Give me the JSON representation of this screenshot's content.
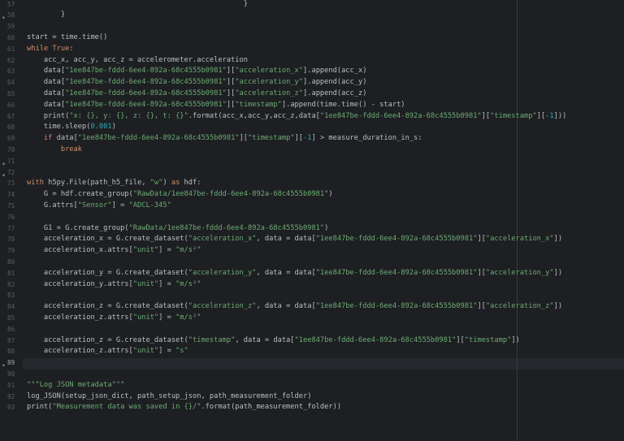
{
  "editor": {
    "current_line": 89,
    "lines": [
      {
        "n": "57",
        "segs": [
          {
            "t": "                                                   }",
            "c": "fn"
          }
        ]
      },
      {
        "n": "58",
        "fold": true,
        "segs": [
          {
            "t": "        }",
            "c": "fn"
          }
        ]
      },
      {
        "n": "59",
        "segs": []
      },
      {
        "n": "60",
        "segs": [
          {
            "t": "start = time.time()",
            "c": "fn"
          }
        ]
      },
      {
        "n": "61",
        "segs": [
          {
            "t": "while",
            "c": "kw"
          },
          {
            "t": " ",
            "c": "fn"
          },
          {
            "t": "True",
            "c": "kw"
          },
          {
            "t": ":",
            "c": "fn"
          }
        ]
      },
      {
        "n": "62",
        "segs": [
          {
            "t": "    acc_x, acc_y, acc_z = accelerometer.acceleration",
            "c": "fn"
          }
        ]
      },
      {
        "n": "63",
        "segs": [
          {
            "t": "    data[",
            "c": "fn"
          },
          {
            "t": "\"1ee847be-fddd-6ee4-892a-68c4555b0981\"",
            "c": "str"
          },
          {
            "t": "][",
            "c": "fn"
          },
          {
            "t": "\"acceleration_x\"",
            "c": "str"
          },
          {
            "t": "].append(acc_x)",
            "c": "fn"
          }
        ]
      },
      {
        "n": "64",
        "segs": [
          {
            "t": "    data[",
            "c": "fn"
          },
          {
            "t": "\"1ee847be-fddd-6ee4-892a-68c4555b0981\"",
            "c": "str"
          },
          {
            "t": "][",
            "c": "fn"
          },
          {
            "t": "\"acceleration_y\"",
            "c": "str"
          },
          {
            "t": "].append(acc_y)",
            "c": "fn"
          }
        ]
      },
      {
        "n": "65",
        "segs": [
          {
            "t": "    data[",
            "c": "fn"
          },
          {
            "t": "\"1ee847be-fddd-6ee4-892a-68c4555b0981\"",
            "c": "str"
          },
          {
            "t": "][",
            "c": "fn"
          },
          {
            "t": "\"acceleration_z\"",
            "c": "str"
          },
          {
            "t": "].append(acc_z)",
            "c": "fn"
          }
        ]
      },
      {
        "n": "66",
        "segs": [
          {
            "t": "    data[",
            "c": "fn"
          },
          {
            "t": "\"1ee847be-fddd-6ee4-892a-68c4555b0981\"",
            "c": "str"
          },
          {
            "t": "][",
            "c": "fn"
          },
          {
            "t": "\"timestamp\"",
            "c": "str"
          },
          {
            "t": "].append(time.time() - start)",
            "c": "fn"
          }
        ]
      },
      {
        "n": "67",
        "segs": [
          {
            "t": "    print(",
            "c": "fn"
          },
          {
            "t": "\"x: {}, y: {}, z: {}, t: {}\"",
            "c": "str"
          },
          {
            "t": ".format(acc_x,acc_y,acc_z,data[",
            "c": "fn"
          },
          {
            "t": "\"1ee847be-fddd-6ee4-892a-68c4555b0981\"",
            "c": "str"
          },
          {
            "t": "][",
            "c": "fn"
          },
          {
            "t": "\"timestamp\"",
            "c": "str"
          },
          {
            "t": "][",
            "c": "fn"
          },
          {
            "t": "-1",
            "c": "num"
          },
          {
            "t": "]))",
            "c": "fn"
          }
        ]
      },
      {
        "n": "68",
        "segs": [
          {
            "t": "    time.sleep(",
            "c": "fn"
          },
          {
            "t": "0.001",
            "c": "num"
          },
          {
            "t": ")",
            "c": "fn"
          }
        ]
      },
      {
        "n": "69",
        "segs": [
          {
            "t": "    ",
            "c": "fn"
          },
          {
            "t": "if",
            "c": "kw"
          },
          {
            "t": " data[",
            "c": "fn"
          },
          {
            "t": "\"1ee847be-fddd-6ee4-892a-68c4555b0981\"",
            "c": "str"
          },
          {
            "t": "][",
            "c": "fn"
          },
          {
            "t": "\"timestamp\"",
            "c": "str"
          },
          {
            "t": "][",
            "c": "fn"
          },
          {
            "t": "-1",
            "c": "num"
          },
          {
            "t": "] > measure_duration_in_s:",
            "c": "fn"
          }
        ]
      },
      {
        "n": "70",
        "segs": [
          {
            "t": "        ",
            "c": "fn"
          },
          {
            "t": "break",
            "c": "kw"
          }
        ]
      },
      {
        "n": "71",
        "fold": true,
        "segs": []
      },
      {
        "n": "72",
        "fold": true,
        "segs": []
      },
      {
        "n": "73",
        "segs": [
          {
            "t": "with",
            "c": "kw"
          },
          {
            "t": " h5py.File(path_h5_file, ",
            "c": "fn"
          },
          {
            "t": "\"w\"",
            "c": "str"
          },
          {
            "t": ") ",
            "c": "fn"
          },
          {
            "t": "as",
            "c": "kw"
          },
          {
            "t": " hdf:",
            "c": "fn"
          }
        ]
      },
      {
        "n": "74",
        "segs": [
          {
            "t": "    G = hdf.create_group(",
            "c": "fn"
          },
          {
            "t": "\"RawData/1ee847be-fddd-6ee4-892a-68c4555b0981\"",
            "c": "str"
          },
          {
            "t": ")",
            "c": "fn"
          }
        ]
      },
      {
        "n": "75",
        "segs": [
          {
            "t": "    G.attrs[",
            "c": "fn"
          },
          {
            "t": "\"Sensor\"",
            "c": "str"
          },
          {
            "t": "] = ",
            "c": "fn"
          },
          {
            "t": "\"ADCL-345\"",
            "c": "str"
          }
        ]
      },
      {
        "n": "76",
        "segs": []
      },
      {
        "n": "77",
        "segs": [
          {
            "t": "    G1 = G.create_group(",
            "c": "fn"
          },
          {
            "t": "\"RawData/1ee847be-fddd-6ee4-892a-68c4555b0981\"",
            "c": "str"
          },
          {
            "t": ")",
            "c": "fn"
          }
        ]
      },
      {
        "n": "78",
        "segs": [
          {
            "t": "    acceleration_x = G.create_dataset(",
            "c": "fn"
          },
          {
            "t": "\"acceleration_x\"",
            "c": "str"
          },
          {
            "t": ", data = data[",
            "c": "fn"
          },
          {
            "t": "\"1ee847be-fddd-6ee4-892a-68c4555b0981\"",
            "c": "str"
          },
          {
            "t": "][",
            "c": "fn"
          },
          {
            "t": "\"acceleration_x\"",
            "c": "str"
          },
          {
            "t": "])",
            "c": "fn"
          }
        ]
      },
      {
        "n": "79",
        "segs": [
          {
            "t": "    acceleration_x.attrs[",
            "c": "fn"
          },
          {
            "t": "\"unit\"",
            "c": "str"
          },
          {
            "t": "] = ",
            "c": "fn"
          },
          {
            "t": "\"m/s²\"",
            "c": "str"
          }
        ]
      },
      {
        "n": "80",
        "segs": []
      },
      {
        "n": "81",
        "segs": [
          {
            "t": "    acceleration_y = G.create_dataset(",
            "c": "fn"
          },
          {
            "t": "\"acceleration_y\"",
            "c": "str"
          },
          {
            "t": ", data = data[",
            "c": "fn"
          },
          {
            "t": "\"1ee847be-fddd-6ee4-892a-68c4555b0981\"",
            "c": "str"
          },
          {
            "t": "][",
            "c": "fn"
          },
          {
            "t": "\"acceleration_y\"",
            "c": "str"
          },
          {
            "t": "])",
            "c": "fn"
          }
        ]
      },
      {
        "n": "82",
        "segs": [
          {
            "t": "    acceleration_y.attrs[",
            "c": "fn"
          },
          {
            "t": "\"unit\"",
            "c": "str"
          },
          {
            "t": "] = ",
            "c": "fn"
          },
          {
            "t": "\"m/s²\"",
            "c": "str"
          }
        ]
      },
      {
        "n": "83",
        "segs": []
      },
      {
        "n": "84",
        "segs": [
          {
            "t": "    acceleration_z = G.create_dataset(",
            "c": "fn"
          },
          {
            "t": "\"acceleration_z\"",
            "c": "str"
          },
          {
            "t": ", data = data[",
            "c": "fn"
          },
          {
            "t": "\"1ee847be-fddd-6ee4-892a-68c4555b0981\"",
            "c": "str"
          },
          {
            "t": "][",
            "c": "fn"
          },
          {
            "t": "\"acceleration_z\"",
            "c": "str"
          },
          {
            "t": "])",
            "c": "fn"
          }
        ]
      },
      {
        "n": "85",
        "segs": [
          {
            "t": "    acceleration_z.attrs[",
            "c": "fn"
          },
          {
            "t": "\"unit\"",
            "c": "str"
          },
          {
            "t": "] = ",
            "c": "fn"
          },
          {
            "t": "\"m/s²\"",
            "c": "str"
          }
        ]
      },
      {
        "n": "86",
        "segs": []
      },
      {
        "n": "87",
        "segs": [
          {
            "t": "    acceleration_z = G.create_dataset(",
            "c": "fn"
          },
          {
            "t": "\"timestamp\"",
            "c": "str"
          },
          {
            "t": ", data = data[",
            "c": "fn"
          },
          {
            "t": "\"1ee847be-fddd-6ee4-892a-68c4555b0981\"",
            "c": "str"
          },
          {
            "t": "][",
            "c": "fn"
          },
          {
            "t": "\"timestamp\"",
            "c": "str"
          },
          {
            "t": "])",
            "c": "fn"
          }
        ]
      },
      {
        "n": "88",
        "segs": [
          {
            "t": "    acceleration_z.attrs[",
            "c": "fn"
          },
          {
            "t": "\"unit\"",
            "c": "str"
          },
          {
            "t": "] = ",
            "c": "fn"
          },
          {
            "t": "\"s\"",
            "c": "str"
          }
        ]
      },
      {
        "n": "89",
        "fold": true,
        "segs": []
      },
      {
        "n": "90",
        "segs": []
      },
      {
        "n": "91",
        "segs": [
          {
            "t": "\"\"\"Log JSON metadata\"\"\"",
            "c": "str"
          }
        ]
      },
      {
        "n": "92",
        "segs": [
          {
            "t": "log_JSON(setup_json_dict, path_setup_json, path_measurement_folder)",
            "c": "fn"
          }
        ]
      },
      {
        "n": "93",
        "segs": [
          {
            "t": "print(",
            "c": "fn"
          },
          {
            "t": "\"Measurement data was saved in {}/\"",
            "c": "str"
          },
          {
            "t": ".format(path_measurement_folder))",
            "c": "fn"
          }
        ]
      }
    ]
  }
}
